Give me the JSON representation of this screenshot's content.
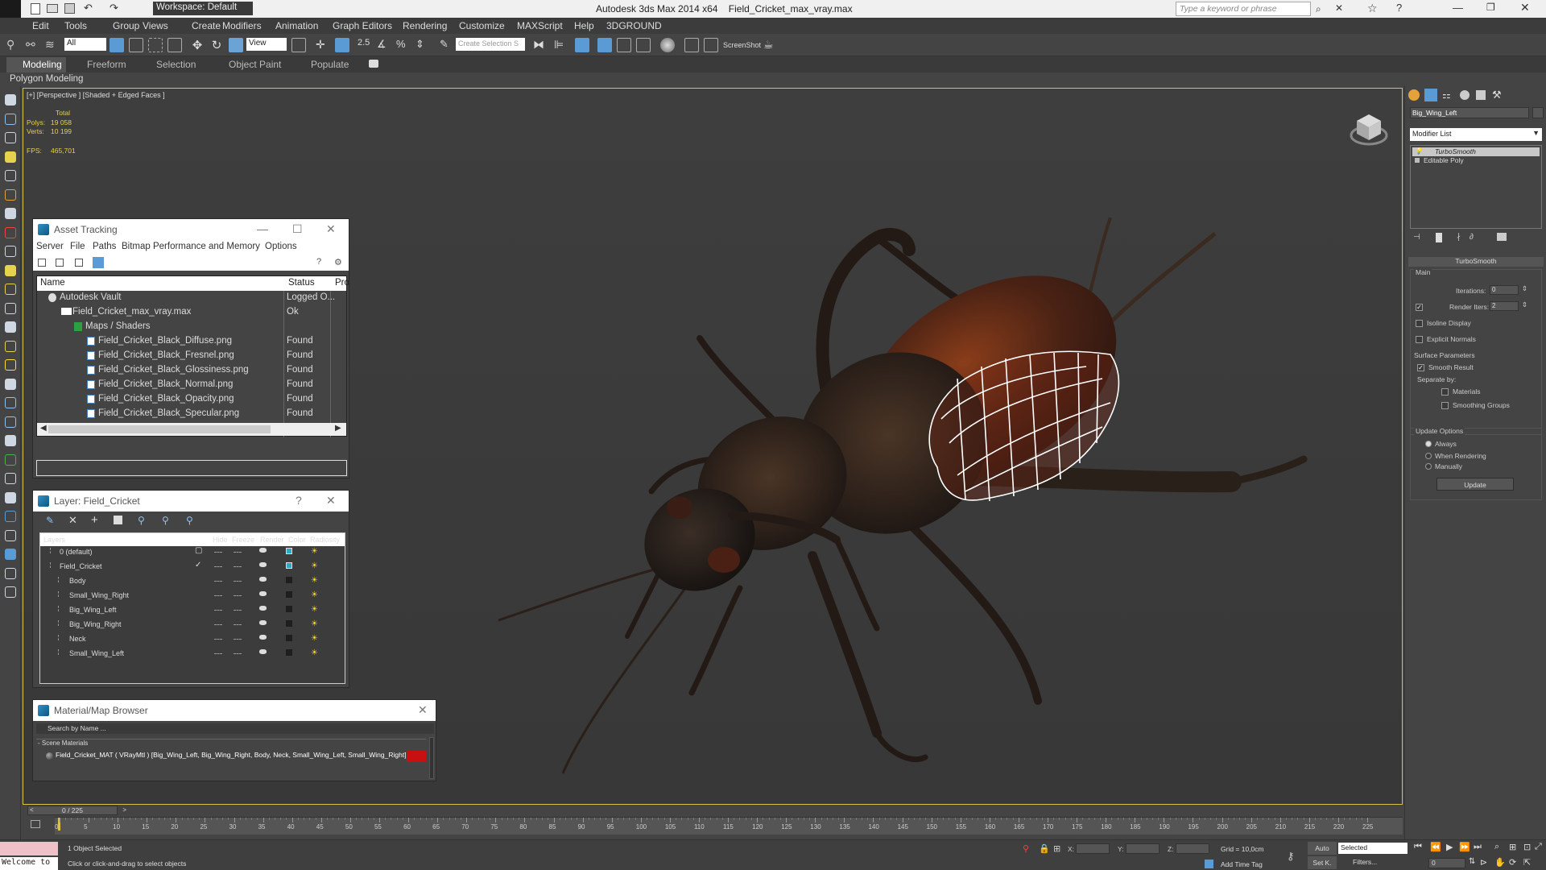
{
  "titlebar": {
    "app_title": "Autodesk 3ds Max 2014 x64",
    "file_title": "Field_Cricket_max_vray.max",
    "workspace": "Workspace: Default",
    "search_placeholder": "Type a keyword or phrase"
  },
  "menu": [
    "Edit",
    "Tools",
    "Group",
    "Views",
    "Create",
    "Modifiers",
    "Animation",
    "Graph Editors",
    "Rendering",
    "Customize",
    "MAXScript",
    "Help",
    "3DGROUND"
  ],
  "toolbar": {
    "selection_filter": "All",
    "ref_coord": "View",
    "named_selection_placeholder": "Create Selection S",
    "screenshot_label": "ScreenShot"
  },
  "ribbon": {
    "tabs": [
      "Modeling",
      "Freeform",
      "Selection",
      "Object Paint",
      "Populate"
    ],
    "sub": "Polygon Modeling"
  },
  "viewport": {
    "label": "[+] [Perspective ] [Shaded + Edged Faces ]",
    "stats": {
      "total_label": "Total",
      "polys_label": "Polys:",
      "polys_value": "19 058",
      "verts_label": "Verts:",
      "verts_value": "10 199",
      "fps_label": "FPS:",
      "fps_value": "465,701"
    }
  },
  "asset_tracking": {
    "title": "Asset Tracking",
    "menu": [
      "Server",
      "File",
      "Paths",
      "Bitmap Performance and Memory",
      "Options"
    ],
    "columns": [
      "Name",
      "Status",
      "Pro"
    ],
    "rows": [
      {
        "name": "Autodesk Vault",
        "status": "Logged O..."
      },
      {
        "name": "Field_Cricket_max_vray.max",
        "status": "Ok"
      },
      {
        "name": "Maps / Shaders",
        "status": ""
      },
      {
        "name": "Field_Cricket_Black_Diffuse.png",
        "status": "Found"
      },
      {
        "name": "Field_Cricket_Black_Fresnel.png",
        "status": "Found"
      },
      {
        "name": "Field_Cricket_Black_Glossiness.png",
        "status": "Found"
      },
      {
        "name": "Field_Cricket_Black_Normal.png",
        "status": "Found"
      },
      {
        "name": "Field_Cricket_Black_Opacity.png",
        "status": "Found"
      },
      {
        "name": "Field_Cricket_Black_Specular.png",
        "status": "Found"
      }
    ]
  },
  "layer_manager": {
    "title": "Layer: Field_Cricket",
    "columns": [
      "Layers",
      "Hide",
      "Freeze",
      "Render",
      "Color",
      "Radiosity"
    ],
    "rows": [
      {
        "name": "0 (default)"
      },
      {
        "name": "Field_Cricket"
      },
      {
        "name": "Body"
      },
      {
        "name": "Small_Wing_Right"
      },
      {
        "name": "Big_Wing_Left"
      },
      {
        "name": "Big_Wing_Right"
      },
      {
        "name": "Neck"
      },
      {
        "name": "Small_Wing_Left"
      }
    ]
  },
  "material_browser": {
    "title": "Material/Map Browser",
    "search_placeholder": "Search by Name ...",
    "group": "- Scene Materials",
    "item": "Field_Cricket_MAT ( VRayMtl ) [Big_Wing_Left, Big_Wing_Right, Body, Neck, Small_Wing_Left, Small_Wing_Right]"
  },
  "command_panel": {
    "object_name": "Big_Wing_Left",
    "modifier_list": "Modifier List",
    "stack": [
      "TurboSmooth",
      "Editable Poly"
    ],
    "rollout_title": "TurboSmooth",
    "main_label": "Main",
    "iterations_label": "Iterations:",
    "iterations_value": "0",
    "render_iters_label": "Render Iters:",
    "render_iters_value": "2",
    "isoline_label": "Isoline Display",
    "explicit_normals_label": "Explicit Normals",
    "surface_params_label": "Surface Parameters",
    "smooth_result_label": "Smooth Result",
    "separate_by_label": "Separate by:",
    "materials_label": "Materials",
    "smoothing_groups_label": "Smoothing Groups",
    "update_options_label": "Update Options",
    "always_label": "Always",
    "when_rendering_label": "When Rendering",
    "manually_label": "Manually",
    "update_button": "Update"
  },
  "timeline": {
    "frame_counter": "0 / 225",
    "ticks": [
      "0",
      "5",
      "10",
      "15",
      "20",
      "25",
      "30",
      "35",
      "40",
      "45",
      "50",
      "55",
      "60",
      "65",
      "70",
      "75",
      "80",
      "85",
      "90",
      "95",
      "100",
      "105",
      "110",
      "115",
      "120",
      "125",
      "130",
      "135",
      "140",
      "145",
      "150",
      "155",
      "160",
      "165",
      "170",
      "175",
      "180",
      "185",
      "190",
      "195",
      "200",
      "205",
      "210",
      "215",
      "220",
      "225"
    ]
  },
  "statusbar": {
    "welcome": "Welcome to",
    "selected_text": "1 Object Selected",
    "prompt": "Click or click-and-drag to select objects",
    "x_label": "X:",
    "y_label": "Y:",
    "z_label": "Z:",
    "grid": "Grid = 10,0cm",
    "add_time_tag": "Add Time Tag",
    "auto_label": "Auto",
    "set_key_label": "Set K.",
    "key_filter": "Selected",
    "filters_label": "Filters...",
    "frame_value": "0"
  },
  "colors": {
    "accent_yellow": "#d8c248",
    "selection_blue": "#5b9bd5",
    "material_red": "#c81010"
  }
}
